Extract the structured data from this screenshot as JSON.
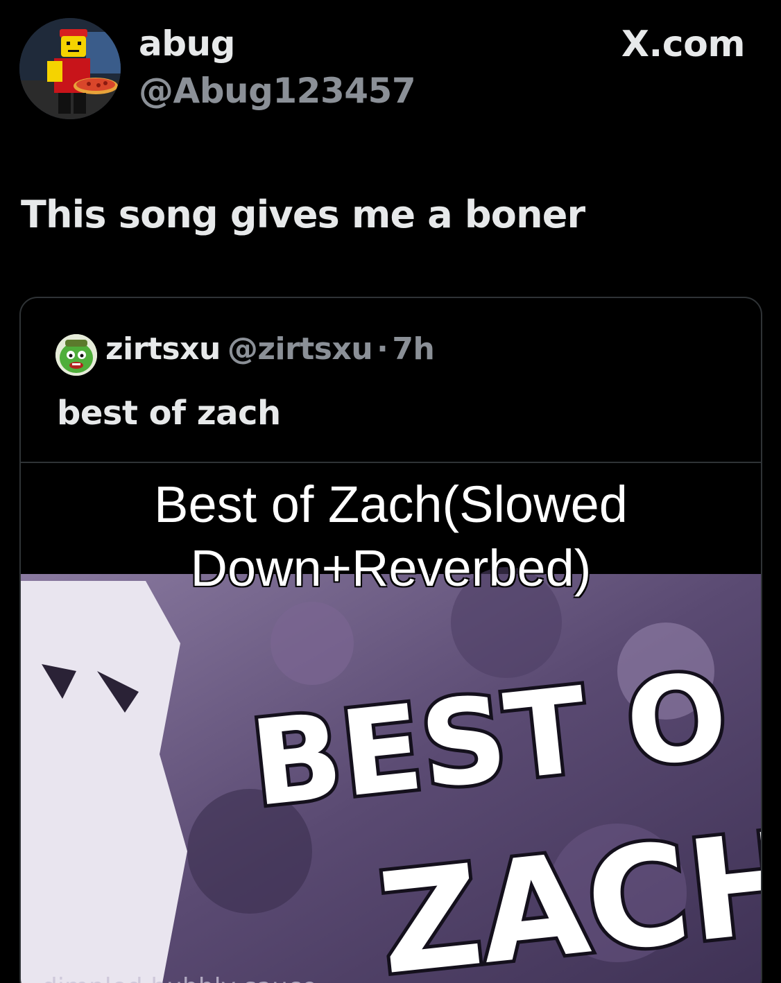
{
  "post": {
    "display_name": "abug",
    "handle": "@Abug123457",
    "brand": "X.com",
    "text": "This song gives me a boner",
    "avatar_icon": "roblox-pizza-character-avatar"
  },
  "quoted": {
    "display_name": "zirtsxu",
    "handle": "@zirtsxu",
    "separator": "·",
    "time": "7h",
    "text": "best of zach",
    "avatar_icon": "green-cartoon-character-avatar",
    "media": {
      "caption_line1": "Best of Zach(Slowed",
      "caption_line2": "Down+Reverbed)",
      "art_text_top": "BEST O",
      "art_text_bottom": "ZACH",
      "art_footer": "dimpled bubbly sauce"
    }
  },
  "colors": {
    "background": "#000000",
    "primary_text": "#e7e9ea",
    "secondary_text": "#8b9097",
    "border": "#2f3336",
    "media_purple": "#6e5d86"
  }
}
